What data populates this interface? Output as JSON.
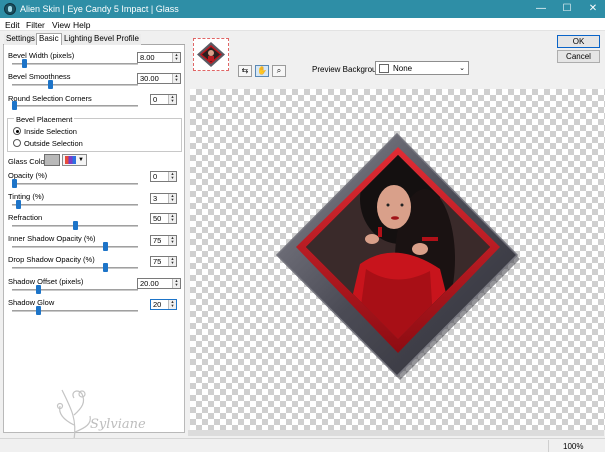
{
  "window": {
    "title": "Alien Skin | Eye Candy 5 Impact | Glass",
    "minimize_glyph": "—",
    "maximize_glyph": "☐",
    "close_glyph": "✕"
  },
  "menu": [
    "Edit",
    "Filter",
    "View",
    "Help"
  ],
  "tabs": [
    "Settings",
    "Basic",
    "Lighting",
    "Bevel Profile"
  ],
  "active_tab": "Basic",
  "controls": {
    "bevel_width": {
      "label": "Bevel Width (pixels)",
      "value": "8.00",
      "slider": 0.08
    },
    "bevel_smoothness": {
      "label": "Bevel Smoothness",
      "value": "30.00",
      "slider": 0.3
    },
    "round_corners": {
      "label": "Round Selection Corners",
      "value": "0",
      "slider": 0.0
    },
    "bevel_placement": {
      "label": "Bevel Placement",
      "options": [
        "Inside Selection",
        "Outside Selection"
      ],
      "selected": "Inside Selection"
    },
    "glass_color": {
      "label": "Glass Color",
      "color": "#b9b9b9"
    },
    "opacity": {
      "label": "Opacity (%)",
      "value": "0",
      "slider": 0.0
    },
    "tinting": {
      "label": "Tinting (%)",
      "value": "3",
      "slider": 0.03
    },
    "refraction": {
      "label": "Refraction",
      "value": "50",
      "slider": 0.5
    },
    "inner_shadow_opacity": {
      "label": "Inner Shadow Opacity (%)",
      "value": "75",
      "slider": 0.75
    },
    "drop_shadow_opacity": {
      "label": "Drop Shadow Opacity (%)",
      "value": "75",
      "slider": 0.75
    },
    "shadow_offset": {
      "label": "Shadow Offset (pixels)",
      "value": "20.00",
      "slider": 0.2
    },
    "shadow_glow": {
      "label": "Shadow Glow",
      "value": "20",
      "slider": 0.2
    }
  },
  "watermark_text": "Sylviane",
  "preview": {
    "background_label": "Preview Background:",
    "background_value": "None"
  },
  "buttons": {
    "ok": "OK",
    "cancel": "Cancel"
  },
  "status": {
    "zoom": "100%"
  },
  "colors": {
    "titlebar": "#2e8ea6",
    "accent": "#1d74c8",
    "frame_red": "#c0131b",
    "frame_grey": "#5a5a63"
  },
  "icons": [
    "alien-skin-app-icon",
    "preview-thumbnail-icon",
    "compare-tool-icon",
    "hand-tool-icon",
    "zoom-tool-icon"
  ]
}
